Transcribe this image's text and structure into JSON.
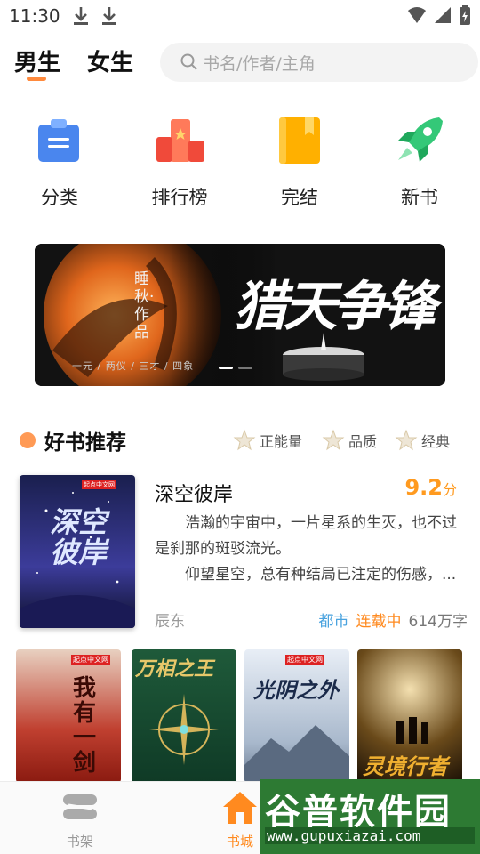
{
  "status_bar": {
    "time": "11:30"
  },
  "header": {
    "tabs": [
      {
        "label": "男生",
        "active": true
      },
      {
        "label": "女生",
        "active": false
      }
    ],
    "search_placeholder": "书名/作者/主角"
  },
  "categories": [
    {
      "label": "分类",
      "icon": "category-icon",
      "color": "#5a8ff0"
    },
    {
      "label": "排行榜",
      "icon": "ranking-icon",
      "color": "#f05a4a"
    },
    {
      "label": "完结",
      "icon": "completed-book-icon",
      "color": "#ffb800"
    },
    {
      "label": "新书",
      "icon": "rocket-icon",
      "color": "#3ccf7a"
    }
  ],
  "banner": {
    "author_line": "睡秋·作品",
    "title": "猎天争锋",
    "tagline": "一元 / 两仪 / 三才 / 四象",
    "slides": 2,
    "active_slide": 1
  },
  "recommend": {
    "title": "好书推荐",
    "filters": [
      "正能量",
      "品质",
      "经典"
    ],
    "featured": {
      "name": "深空彼岸",
      "score": "9.2",
      "score_unit": "分",
      "desc_lines": [
        "浩瀚的宇宙中，一片星系的生灭，也不过是刹那的斑驳流光。",
        "仰望星空，总有种结局已注定的伤感，..."
      ],
      "author": "辰东",
      "genre": "都市",
      "status": "连载中",
      "words": "614万字",
      "cover_text": "深空彼岸",
      "cover_badge": "起点中文网"
    },
    "books": [
      {
        "cover_text": "我有一剑",
        "badge": "起点中文网"
      },
      {
        "cover_text": "万相之王",
        "badge": ""
      },
      {
        "cover_text": "光阴之外",
        "badge": "起点中文网"
      },
      {
        "cover_text": "灵境行者",
        "badge": ""
      }
    ]
  },
  "bottom_nav": [
    {
      "label": "书架",
      "icon": "bookshelf-icon",
      "active": false
    },
    {
      "label": "书城",
      "icon": "home-icon",
      "active": true
    }
  ],
  "watermark": {
    "title": "谷普软件园",
    "url": "www.gupuxiazai.com"
  }
}
